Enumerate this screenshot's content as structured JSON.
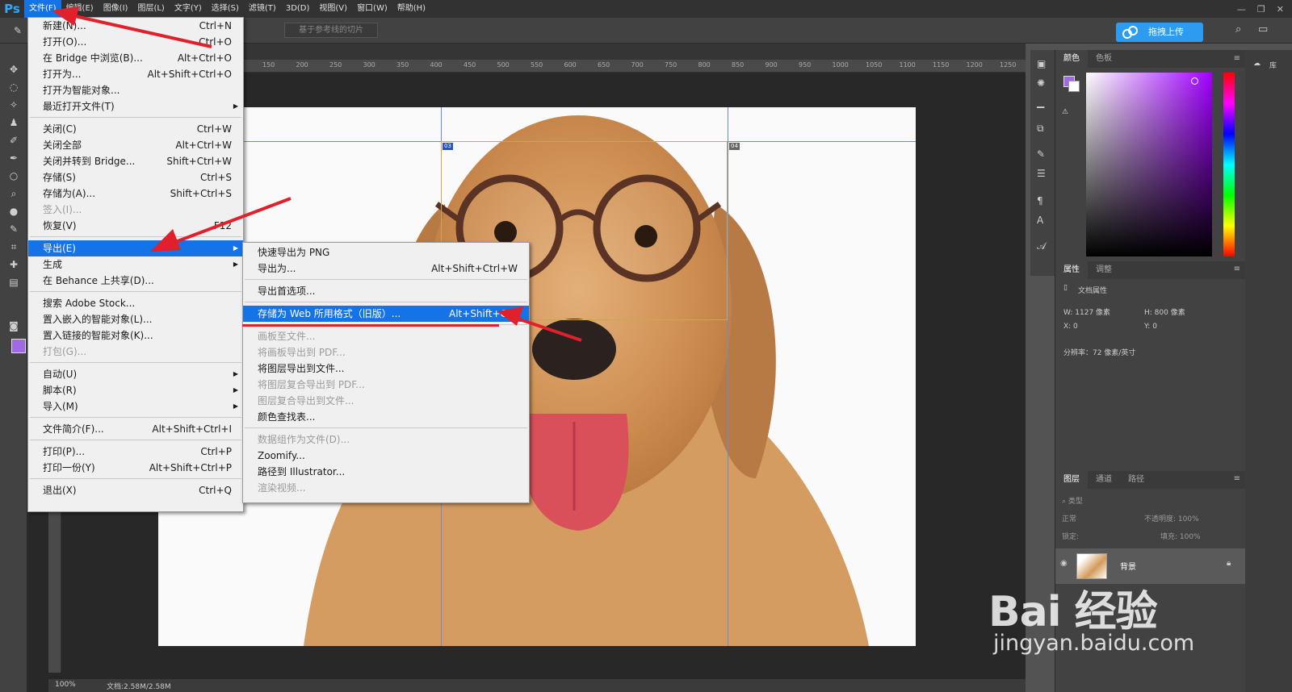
{
  "app": {
    "logo": "Ps",
    "menus": [
      "文件(F)",
      "编辑(E)",
      "图像(I)",
      "图层(L)",
      "文字(Y)",
      "选择(S)",
      "滤镜(T)",
      "3D(D)",
      "视图(V)",
      "窗口(W)",
      "帮助(H)"
    ]
  },
  "options": {
    "slice_button": "基于参考线的切片",
    "upload_button": "拖拽上传"
  },
  "ruler": {
    "ticks": [
      "150",
      "200",
      "250",
      "300",
      "350",
      "400",
      "450",
      "500",
      "550",
      "600",
      "650",
      "700",
      "750",
      "800",
      "850",
      "900",
      "950",
      "1000",
      "1050",
      "1100",
      "1150",
      "1200",
      "1250"
    ]
  },
  "file_menu": {
    "items": [
      {
        "label": "新建(N)...",
        "shortcut": "Ctrl+N"
      },
      {
        "label": "打开(O)...",
        "shortcut": "Ctrl+O"
      },
      {
        "label": "在 Bridge 中浏览(B)...",
        "shortcut": "Alt+Ctrl+O"
      },
      {
        "label": "打开为...",
        "shortcut": "Alt+Shift+Ctrl+O"
      },
      {
        "label": "打开为智能对象...",
        "shortcut": ""
      },
      {
        "label": "最近打开文件(T)",
        "shortcut": ""
      },
      {
        "label": "关闭(C)",
        "shortcut": "Ctrl+W"
      },
      {
        "label": "关闭全部",
        "shortcut": "Alt+Ctrl+W"
      },
      {
        "label": "关闭并转到 Bridge...",
        "shortcut": "Shift+Ctrl+W"
      },
      {
        "label": "存储(S)",
        "shortcut": "Ctrl+S"
      },
      {
        "label": "存储为(A)...",
        "shortcut": "Shift+Ctrl+S"
      },
      {
        "label": "签入(I)...",
        "shortcut": ""
      },
      {
        "label": "恢复(V)",
        "shortcut": "F12"
      },
      {
        "label": "导出(E)",
        "shortcut": ""
      },
      {
        "label": "生成",
        "shortcut": ""
      },
      {
        "label": "在 Behance 上共享(D)...",
        "shortcut": ""
      },
      {
        "label": "搜索 Adobe Stock...",
        "shortcut": ""
      },
      {
        "label": "置入嵌入的智能对象(L)...",
        "shortcut": ""
      },
      {
        "label": "置入链接的智能对象(K)...",
        "shortcut": ""
      },
      {
        "label": "打包(G)...",
        "shortcut": ""
      },
      {
        "label": "自动(U)",
        "shortcut": ""
      },
      {
        "label": "脚本(R)",
        "shortcut": ""
      },
      {
        "label": "导入(M)",
        "shortcut": ""
      },
      {
        "label": "文件简介(F)...",
        "shortcut": "Alt+Shift+Ctrl+I"
      },
      {
        "label": "打印(P)...",
        "shortcut": "Ctrl+P"
      },
      {
        "label": "打印一份(Y)",
        "shortcut": "Alt+Shift+Ctrl+P"
      },
      {
        "label": "退出(X)",
        "shortcut": "Ctrl+Q"
      }
    ]
  },
  "export_menu": {
    "items": [
      {
        "label": "快速导出为 PNG",
        "shortcut": ""
      },
      {
        "label": "导出为...",
        "shortcut": "Alt+Shift+Ctrl+W"
      },
      {
        "label": "导出首选项...",
        "shortcut": ""
      },
      {
        "label": "存储为 Web 所用格式（旧版）...",
        "shortcut": "Alt+Shift+Ctrl"
      },
      {
        "label": "画板至文件...",
        "shortcut": ""
      },
      {
        "label": "将画板导出到 PDF...",
        "shortcut": ""
      },
      {
        "label": "将图层导出到文件...",
        "shortcut": ""
      },
      {
        "label": "将图层复合导出到 PDF...",
        "shortcut": ""
      },
      {
        "label": "图层复合导出到文件...",
        "shortcut": ""
      },
      {
        "label": "颜色查找表...",
        "shortcut": ""
      },
      {
        "label": "数据组作为文件(D)...",
        "shortcut": ""
      },
      {
        "label": "Zoomify...",
        "shortcut": ""
      },
      {
        "label": "路径到 Illustrator...",
        "shortcut": ""
      },
      {
        "label": "渲染视频...",
        "shortcut": ""
      }
    ]
  },
  "canvas": {
    "slice_tag_1": "03",
    "slice_tag_2": "04"
  },
  "status": {
    "zoom": "100%",
    "doc": "文档:2.58M/2.58M"
  },
  "color_panel": {
    "tabs": [
      "颜色",
      "色板"
    ]
  },
  "properties_panel": {
    "tabs": [
      "属性",
      "调整"
    ],
    "title": "文档属性",
    "w": "W:  1127 像素",
    "h": "H:  800 像素",
    "x": "X:  0",
    "y": "Y:  0",
    "resolution": "分辨率：72 像素/英寸"
  },
  "layers_panel": {
    "tabs": [
      "图层",
      "通道",
      "路径"
    ],
    "filter": "类型",
    "blend": "正常",
    "opacity": "不透明度: 100%",
    "lock": "锁定:",
    "fill": "填充: 100%",
    "layer_name": "背景"
  },
  "right_strip": {
    "label": "库"
  },
  "watermark": {
    "logo": "Bai 经验",
    "url": "jingyan.baidu.com"
  },
  "colors": {
    "accent": "#1473e6",
    "foreground": "#a06ae6",
    "annotation": "#e0202a"
  }
}
